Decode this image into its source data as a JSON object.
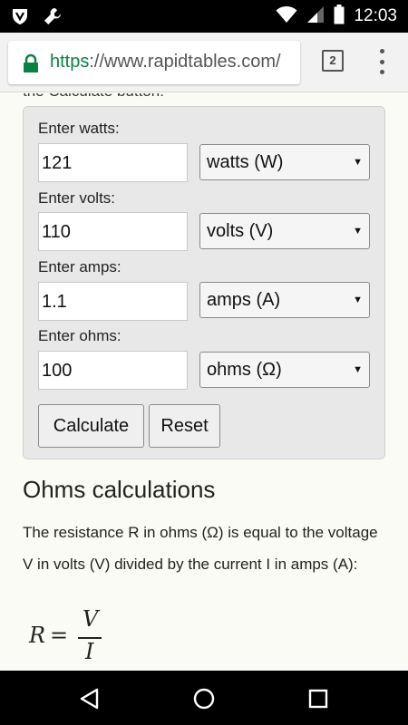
{
  "status_bar": {
    "time": "12:03",
    "icons": [
      "shield-icon",
      "wrench-icon",
      "wifi-icon",
      "signal-icon",
      "battery-icon"
    ]
  },
  "browser": {
    "url_scheme": "https",
    "url_rest": "://www.rapidtables.com/",
    "tab_count": "2",
    "secure_color": "#0b8043"
  },
  "page": {
    "cut_off_text": "the Calculate button:",
    "fields": [
      {
        "label": "Enter watts:",
        "value": "121",
        "unit": "watts (W)"
      },
      {
        "label": "Enter volts:",
        "value": "110",
        "unit": "volts (V)"
      },
      {
        "label": "Enter amps:",
        "value": "1.1",
        "unit": "amps (A)"
      },
      {
        "label": "Enter ohms:",
        "value": "100",
        "unit": "ohms (Ω)"
      }
    ],
    "buttons": {
      "calculate": "Calculate",
      "reset": "Reset"
    },
    "section_heading": "Ohms calculations",
    "paragraph": "The resistance R in ohms (Ω) is equal to the voltage V in volts (V) divided by the current I in amps (A):",
    "formula": {
      "lhs": "R",
      "eq": "=",
      "numerator": "V",
      "denominator": "I"
    }
  }
}
